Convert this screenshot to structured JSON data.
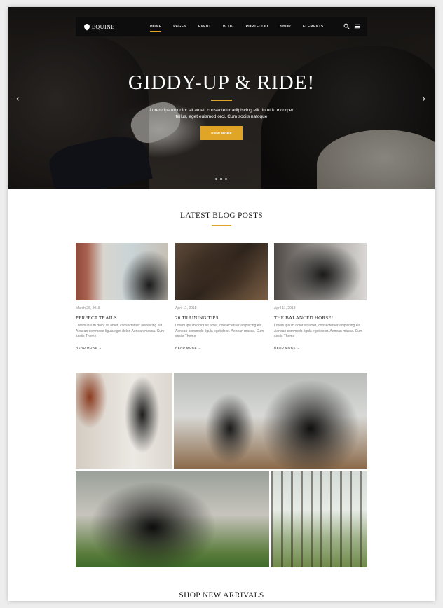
{
  "header": {
    "logo_text": "EQUINE",
    "menu": [
      {
        "label": "HOME",
        "active": true
      },
      {
        "label": "PAGES",
        "active": false
      },
      {
        "label": "EVENT",
        "active": false
      },
      {
        "label": "BLOG",
        "active": false
      },
      {
        "label": "PORTFOLIO",
        "active": false
      },
      {
        "label": "SHOP",
        "active": false
      },
      {
        "label": "ELEMENTS",
        "active": false
      }
    ],
    "icons": [
      "search-icon",
      "menu-icon"
    ]
  },
  "hero": {
    "title": "GIDDY-UP & RIDE!",
    "text": "Lorem ipsum dolor sit amet, consectetur adipiscing elit. In ut lu mcorper tellus, eget euismod orci. Cum sociis natoque",
    "button_label": "VIEW MORE",
    "slides": 3,
    "active_slide": 2
  },
  "blog": {
    "section_title": "LATEST BLOG POSTS",
    "posts": [
      {
        "date": "March 26, 2018",
        "title": "PERFECT TRAILS",
        "excerpt": "Lorem ipsum dolor sit amet, consectetuer adipiscing elit. Aenean commodo ligula eget dolor. Aenean massa. Cum sociis Theme",
        "read_more": "READ MORE"
      },
      {
        "date": "April 11, 2018",
        "title": "20 TRAINING TIPS",
        "excerpt": "Lorem ipsum dolor sit amet, consectetuer adipiscing elit. Aenean commodo ligula eget dolor. Aenean massa. Cum sociis Theme",
        "read_more": "READ MORE"
      },
      {
        "date": "April 11, 2018",
        "title": "THE BALANCED HORSE!",
        "excerpt": "Lorem ipsum dolor sit amet, consectetuer adipiscing elit. Aenean commodo ligula eget dolor. Aenean massa. Cum sociis Theme",
        "read_more": "READ MORE"
      }
    ]
  },
  "shop": {
    "section_title": "SHOP NEW ARRIVALS"
  },
  "colors": {
    "accent": "#e0a526",
    "nav_bg": "#0d0d0d",
    "text_dark": "#1a1a1a",
    "text_muted": "#777777"
  }
}
